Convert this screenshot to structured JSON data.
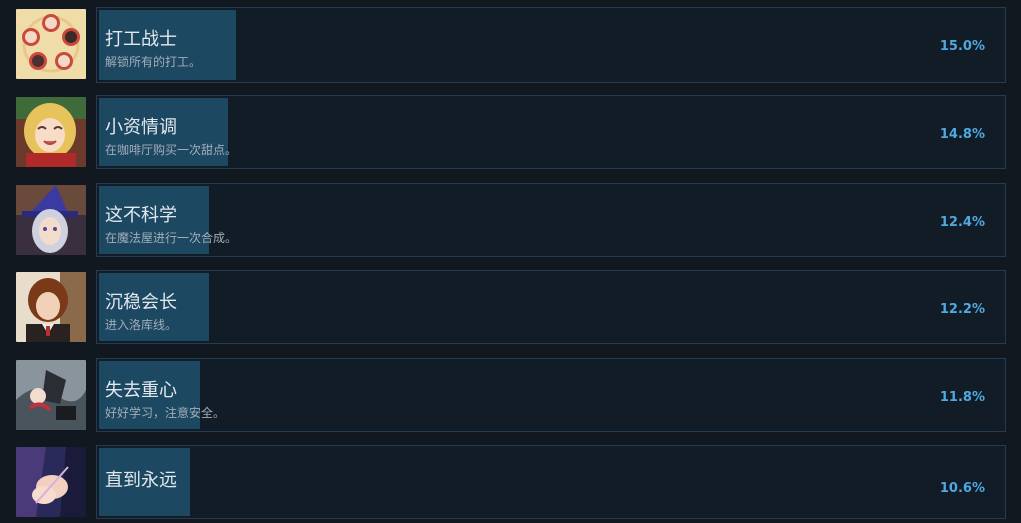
{
  "achievements": [
    {
      "title": "打工战士",
      "description": "解锁所有的打工。",
      "percent_label": "15.0%",
      "percent": 15.0,
      "icon": "medallion-portraits-icon"
    },
    {
      "title": "小资情调",
      "description": "在咖啡厅购买一次甜点。",
      "percent_label": "14.8%",
      "percent": 14.8,
      "icon": "blonde-girl-portrait-icon"
    },
    {
      "title": "这不科学",
      "description": "在魔法屋进行一次合成。",
      "percent_label": "12.4%",
      "percent": 12.4,
      "icon": "witch-portrait-icon"
    },
    {
      "title": "沉稳会长",
      "description": "进入洛库线。",
      "percent_label": "12.2%",
      "percent": 12.2,
      "icon": "brown-hair-man-portrait-icon"
    },
    {
      "title": "失去重心",
      "description": "好好学习，注意安全。",
      "percent_label": "11.8%",
      "percent": 11.8,
      "icon": "falling-scene-icon"
    },
    {
      "title": "直到永远",
      "description": "",
      "percent_label": "10.6%",
      "percent": 10.6,
      "icon": "holding-hands-icon"
    }
  ],
  "colors": {
    "background": "#111820",
    "panel": "#121c27",
    "panel_border": "#233c53",
    "progress_fill": "#1c4862",
    "percent_text": "#4fa8e0"
  }
}
